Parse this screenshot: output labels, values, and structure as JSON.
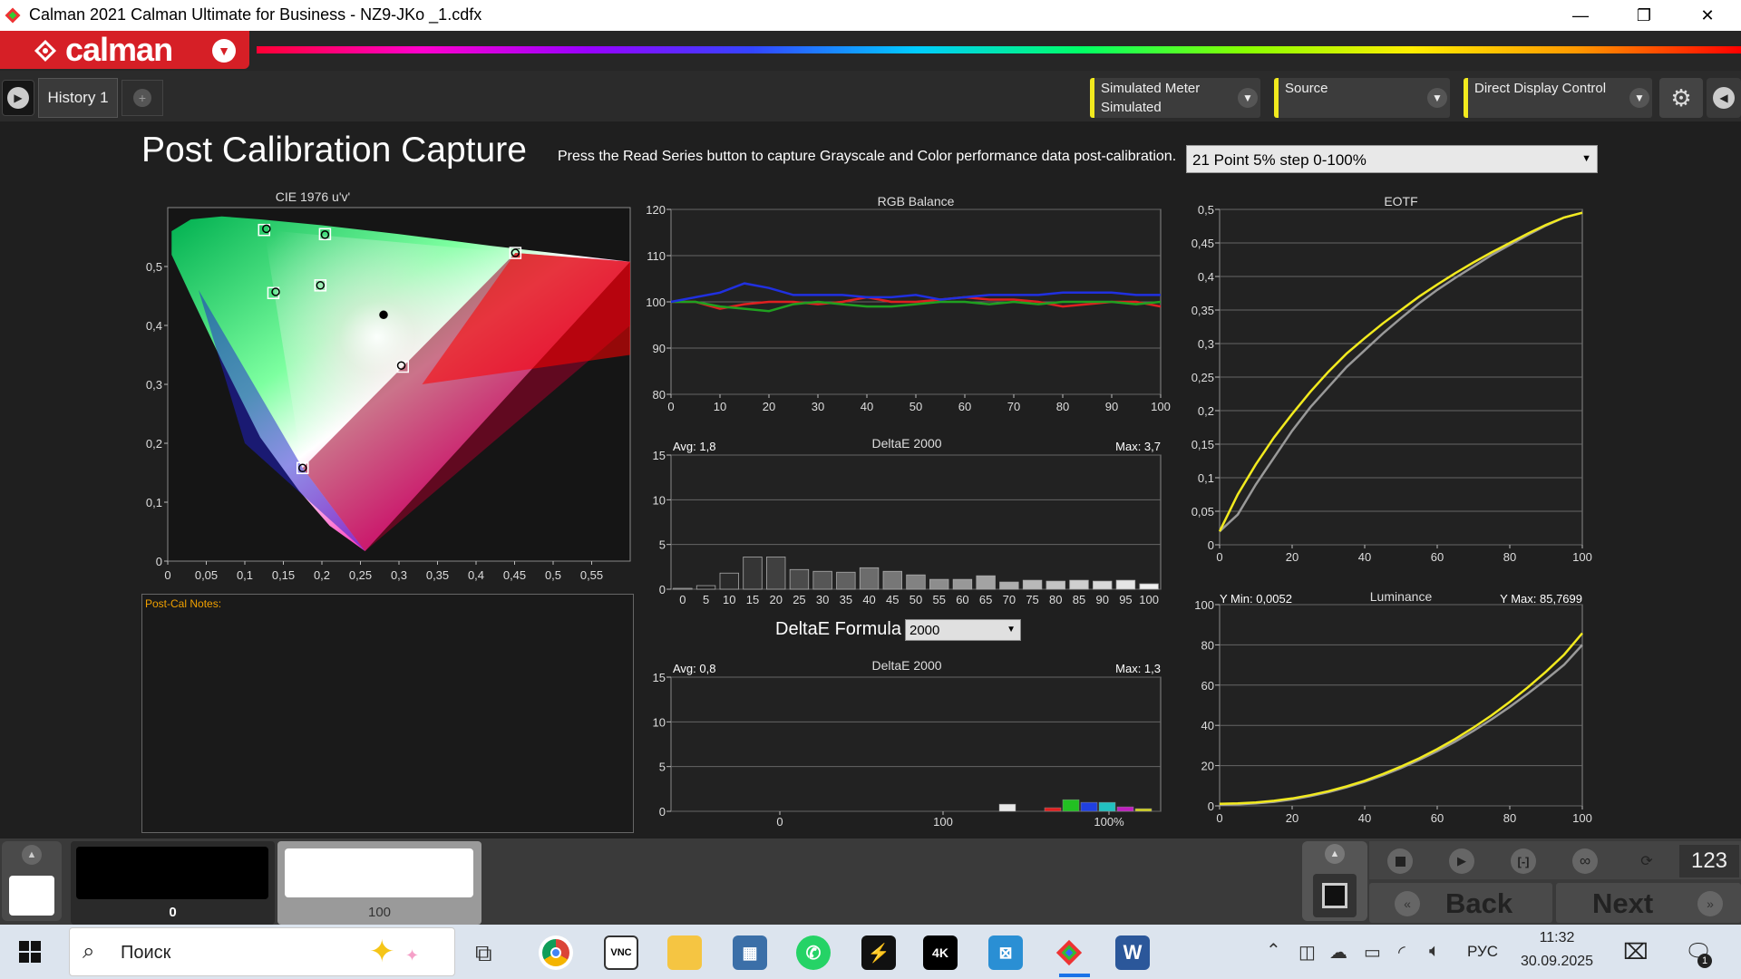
{
  "window": {
    "title": "Calman 2021 Calman Ultimate for Business  - NZ9-JKo _1.cdfx",
    "minimize": "—",
    "restore": "❐",
    "close": "✕"
  },
  "brand": {
    "logo": "calman"
  },
  "tabs": {
    "history": "History 1",
    "add": "+"
  },
  "devices": {
    "meter_label": "Simulated Meter",
    "meter_value": "Simulated",
    "source_label": "Source",
    "display_label": "Direct Display Control"
  },
  "page": {
    "title": "Post Calibration Capture",
    "instruction": "Press the Read Series button to capture Grayscale and Color performance data post-calibration.",
    "series_select": "21 Point 5% step 0-100%"
  },
  "notes": {
    "label": "Post-Cal Notes:"
  },
  "deltae_formula": {
    "label": "DeltaE Formula",
    "value": "2000"
  },
  "chart_data": [
    {
      "type": "scatter",
      "title": "CIE 1976 u'v'",
      "x_ticks": [
        "0",
        "0,05",
        "0,1",
        "0,15",
        "0,2",
        "0,25",
        "0,3",
        "0,35",
        "0,4",
        "0,45",
        "0,5",
        "0,55"
      ],
      "y_ticks": [
        "0",
        "0,1",
        "0,2",
        "0,3",
        "0,4",
        "0,5"
      ],
      "xlim": [
        0,
        0.6
      ],
      "ylim": [
        0,
        0.6
      ],
      "targets": [
        {
          "name": "R",
          "x": 0.451,
          "y": 0.523
        },
        {
          "name": "G",
          "x": 0.125,
          "y": 0.562
        },
        {
          "name": "B",
          "x": 0.175,
          "y": 0.158
        },
        {
          "name": "C",
          "x": 0.137,
          "y": 0.455
        },
        {
          "name": "M",
          "x": 0.305,
          "y": 0.33
        },
        {
          "name": "Y",
          "x": 0.204,
          "y": 0.555
        },
        {
          "name": "W",
          "x": 0.198,
          "y": 0.468
        }
      ],
      "measured": [
        {
          "x": 0.451,
          "y": 0.523
        },
        {
          "x": 0.128,
          "y": 0.564
        },
        {
          "x": 0.175,
          "y": 0.158
        },
        {
          "x": 0.14,
          "y": 0.457
        },
        {
          "x": 0.303,
          "y": 0.332
        },
        {
          "x": 0.204,
          "y": 0.554
        },
        {
          "x": 0.198,
          "y": 0.468
        },
        {
          "x": 0.28,
          "y": 0.418
        }
      ]
    },
    {
      "type": "line",
      "title": "RGB Balance",
      "x": [
        0,
        5,
        10,
        15,
        20,
        25,
        30,
        35,
        40,
        45,
        50,
        55,
        60,
        65,
        70,
        75,
        80,
        85,
        90,
        95,
        100
      ],
      "xlim": [
        0,
        100
      ],
      "ylim": [
        80,
        120
      ],
      "x_ticks": [
        "0",
        "10",
        "20",
        "30",
        "40",
        "50",
        "60",
        "70",
        "80",
        "90",
        "100"
      ],
      "y_ticks": [
        "80",
        "90",
        "100",
        "110",
        "120"
      ],
      "series": [
        {
          "color": "#e02020",
          "values": [
            100,
            100,
            98.5,
            99.5,
            100,
            100,
            99.5,
            100,
            101,
            100,
            100,
            100.5,
            101,
            100.5,
            100.5,
            100,
            99,
            99.5,
            100,
            100,
            99
          ]
        },
        {
          "color": "#20a020",
          "values": [
            100,
            100,
            99,
            98.5,
            98,
            99.5,
            100,
            99.5,
            99,
            99,
            99.5,
            100,
            100,
            99.5,
            100,
            99.5,
            100,
            100,
            100,
            99.5,
            100
          ]
        },
        {
          "color": "#2030e0",
          "values": [
            100,
            101,
            102,
            104,
            103,
            101.5,
            101.5,
            101.5,
            101,
            101,
            101.5,
            100.5,
            101,
            101.5,
            101.5,
            101.5,
            102,
            102,
            102,
            101.5,
            101.5
          ]
        }
      ]
    },
    {
      "type": "bar",
      "title": "DeltaE 2000",
      "avg": "Avg: 1,8",
      "max": "Max: 3,7",
      "categories": [
        "0",
        "5",
        "10",
        "15",
        "20",
        "25",
        "30",
        "35",
        "40",
        "45",
        "50",
        "55",
        "60",
        "65",
        "70",
        "75",
        "80",
        "85",
        "90",
        "95",
        "100"
      ],
      "values": [
        0.1,
        0.4,
        1.8,
        3.6,
        3.6,
        2.2,
        2.0,
        1.9,
        2.4,
        2.0,
        1.6,
        1.1,
        1.1,
        1.5,
        0.8,
        1.0,
        0.9,
        1.0,
        0.9,
        1.0,
        0.6
      ],
      "ylim": [
        0,
        15
      ],
      "y_ticks": [
        "0",
        "5",
        "10",
        "15"
      ]
    },
    {
      "type": "bar",
      "title": "DeltaE 2000",
      "avg": "Avg: 0,8",
      "max": "Max: 1,3",
      "x_ticks": [
        "0",
        "100",
        "100%"
      ],
      "categories": [
        "W",
        "R",
        "G",
        "B",
        "C",
        "M",
        "Y"
      ],
      "values": [
        0.8,
        0.4,
        1.3,
        1.0,
        1.0,
        0.5,
        0.3
      ],
      "colors": [
        "#e8e8e8",
        "#e02020",
        "#22c022",
        "#2040e0",
        "#22c0c0",
        "#c020c0",
        "#d0d020"
      ],
      "ylim": [
        0,
        15
      ],
      "y_ticks": [
        "0",
        "5",
        "10",
        "15"
      ]
    },
    {
      "type": "line",
      "title": "EOTF",
      "x": [
        0,
        5,
        10,
        15,
        20,
        25,
        30,
        35,
        40,
        45,
        50,
        55,
        60,
        65,
        70,
        75,
        80,
        85,
        90,
        95,
        100
      ],
      "xlim": [
        0,
        100
      ],
      "ylim": [
        0,
        0.5
      ],
      "x_ticks": [
        "0",
        "20",
        "40",
        "60",
        "80",
        "100"
      ],
      "y_ticks": [
        "0",
        "0,05",
        "0,1",
        "0,15",
        "0,2",
        "0,25",
        "0,3",
        "0,35",
        "0,4",
        "0,45",
        "0,5"
      ],
      "series": [
        {
          "color": "#999999",
          "values": [
            0.02,
            0.045,
            0.09,
            0.13,
            0.17,
            0.205,
            0.235,
            0.265,
            0.29,
            0.315,
            0.338,
            0.36,
            0.38,
            0.398,
            0.415,
            0.432,
            0.447,
            0.462,
            0.476,
            0.488,
            0.495
          ]
        },
        {
          "color": "#f2ea1e",
          "values": [
            0.02,
            0.075,
            0.12,
            0.16,
            0.195,
            0.228,
            0.258,
            0.285,
            0.308,
            0.33,
            0.35,
            0.37,
            0.388,
            0.405,
            0.421,
            0.436,
            0.45,
            0.464,
            0.477,
            0.488,
            0.495
          ]
        }
      ]
    },
    {
      "type": "line",
      "title": "Luminance",
      "ymin_label": "Y Min: 0,0052",
      "ymax_label": "Y Max: 85,7699",
      "x": [
        0,
        5,
        10,
        15,
        20,
        25,
        30,
        35,
        40,
        45,
        50,
        55,
        60,
        65,
        70,
        75,
        80,
        85,
        90,
        95,
        100
      ],
      "xlim": [
        0,
        100
      ],
      "ylim": [
        0,
        100
      ],
      "x_ticks": [
        "0",
        "20",
        "40",
        "60",
        "80",
        "100"
      ],
      "y_ticks": [
        "0",
        "20",
        "40",
        "60",
        "80",
        "100"
      ],
      "series": [
        {
          "color": "#999999",
          "values": [
            0.5,
            0.7,
            1.2,
            2,
            3.2,
            4.8,
            6.8,
            9.2,
            12,
            15.2,
            18.8,
            22.8,
            27.2,
            32,
            37.3,
            43,
            49.2,
            55.8,
            62.8,
            70.2,
            80
          ]
        },
        {
          "color": "#f2ea1e",
          "values": [
            1,
            1.2,
            1.7,
            2.5,
            3.7,
            5.3,
            7.3,
            9.7,
            12.5,
            15.8,
            19.5,
            23.6,
            28.2,
            33.3,
            38.9,
            45,
            51.7,
            58.9,
            66.7,
            75.2,
            85.8
          ]
        }
      ]
    }
  ],
  "patches": {
    "black_value": "0",
    "white_value": "100"
  },
  "controls": {
    "back": "Back",
    "next": "Next",
    "counter": "123"
  },
  "taskbar": {
    "search": "Поиск",
    "lang": "РУС",
    "time": "11:32",
    "date": "30.09.2025",
    "notif": "1"
  }
}
